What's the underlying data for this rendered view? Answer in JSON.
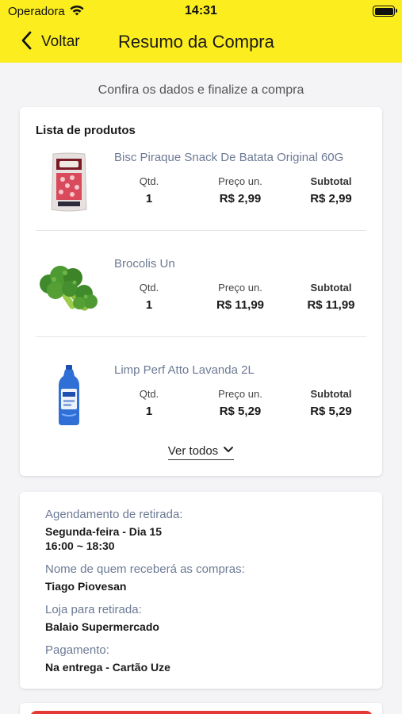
{
  "status_bar": {
    "carrier": "Operadora",
    "time": "14:31"
  },
  "nav": {
    "back_label": "Voltar",
    "title": "Resumo da Compra"
  },
  "subtitle": "Confira os dados e finalize a compra",
  "products": {
    "title": "Lista de produtos",
    "qty_label": "Qtd.",
    "price_label": "Preço un.",
    "subtotal_label": "Subtotal",
    "items": [
      {
        "name": "Bisc Piraque Snack De Batata Original 60G",
        "qty": "1",
        "price": "R$ 2,99",
        "subtotal": "R$ 2,99",
        "image": "biscuit-package-image"
      },
      {
        "name": "Brocolis Un",
        "qty": "1",
        "price": "R$ 11,99",
        "subtotal": "R$ 11,99",
        "image": "broccoli-image"
      },
      {
        "name": "Limp Perf Atto Lavanda 2L",
        "qty": "1",
        "price": "R$ 5,29",
        "subtotal": "R$ 5,29",
        "image": "cleaner-bottle-image"
      }
    ],
    "see_all": "Ver todos"
  },
  "info": {
    "pickup_label": "Agendamento de retirada:",
    "pickup_day": "Segunda-feira - Dia 15",
    "pickup_time": "16:00 ~ 18:30",
    "receiver_label": "Nome de quem receberá as compras:",
    "receiver_name": "Tiago Piovesan",
    "store_label": "Loja para retirada:",
    "store_name": "Balaio Supermercado",
    "payment_label": "Pagamento:",
    "payment_value": "Na entrega - Cartão Uze"
  },
  "colors": {
    "header_bg": "#fced1f",
    "accent_button": "#e53935",
    "muted_text": "#6c7a94"
  }
}
